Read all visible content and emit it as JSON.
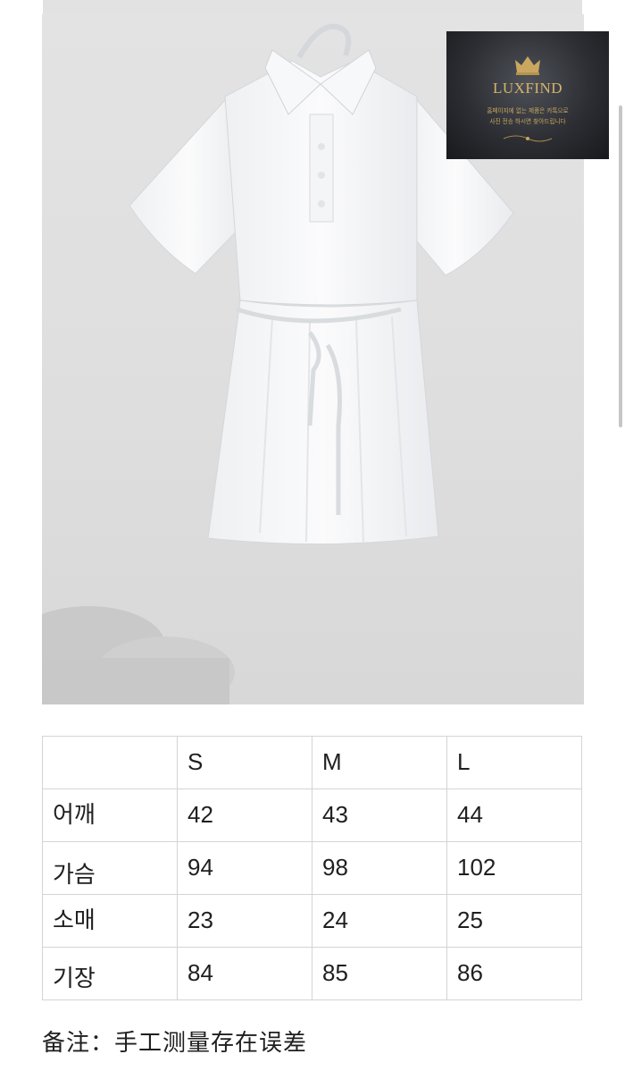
{
  "product_image": {
    "subject": "white-dress-photo",
    "logo": {
      "name": "LUXFIND",
      "line1": "홈페이지에 없는 제품은 카톡으로",
      "line2": "사진 전송 하시면 찾아드립니다",
      "color": "#d8b46a"
    }
  },
  "size_table": {
    "headers": [
      "",
      "S",
      "M",
      "L"
    ],
    "rows": [
      {
        "label": "어깨",
        "values": [
          "42",
          "43",
          "44"
        ]
      },
      {
        "label": "가슴",
        "values": [
          "94",
          "98",
          "102"
        ]
      },
      {
        "label": "소매",
        "values": [
          "23",
          "24",
          "25"
        ]
      },
      {
        "label": "기장",
        "values": [
          "84",
          "85",
          "86"
        ]
      }
    ]
  },
  "note": "备注：手工测量存在误差"
}
